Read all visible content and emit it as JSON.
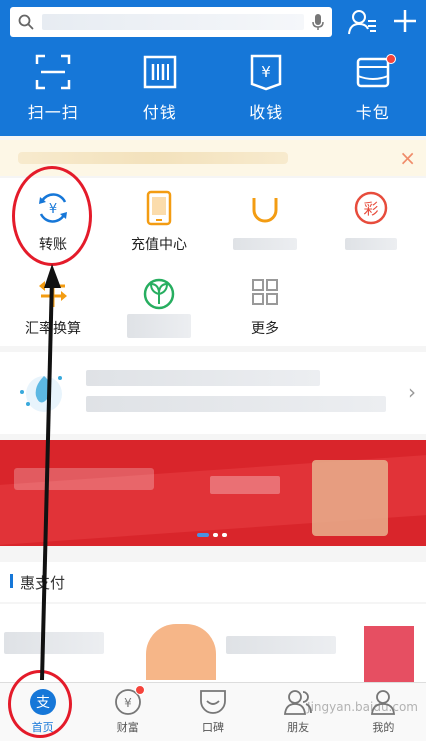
{
  "header": {
    "search_icon": "search-icon",
    "voice_icon": "microphone-icon",
    "contacts_icon": "contacts-icon",
    "add_icon": "plus-icon"
  },
  "quick_actions": [
    {
      "label": "扫一扫",
      "icon": "scan-icon"
    },
    {
      "label": "付钱",
      "icon": "pay-code-icon"
    },
    {
      "label": "收钱",
      "icon": "receive-money-icon"
    },
    {
      "label": "卡包",
      "icon": "card-wallet-icon",
      "badge": true
    }
  ],
  "notice": {
    "close": "×"
  },
  "apps": [
    {
      "label": "转账",
      "icon": "transfer-icon",
      "color": "#1677d8"
    },
    {
      "label": "充值中心",
      "icon": "top-up-icon",
      "color": "#f39c12"
    },
    {
      "label": "",
      "icon": "didi-icon",
      "color": "#f39c12"
    },
    {
      "label": "",
      "icon": "lottery-icon",
      "color": "#e74c3c"
    },
    {
      "label": "汇率换算",
      "icon": "exchange-rate-icon",
      "color": "#f39c12"
    },
    {
      "label": "",
      "icon": "ant-forest-icon",
      "color": "#27ae60"
    },
    {
      "label": "更多",
      "icon": "more-grid-icon",
      "color": "#999999"
    }
  ],
  "section": {
    "title": "惠支付"
  },
  "tabs": [
    {
      "label": "首页",
      "icon": "alipay-home-icon",
      "active": true
    },
    {
      "label": "财富",
      "icon": "wealth-icon",
      "badge": true
    },
    {
      "label": "口碑",
      "icon": "koubei-icon"
    },
    {
      "label": "朋友",
      "icon": "friends-icon"
    },
    {
      "label": "我的",
      "icon": "profile-icon"
    }
  ],
  "watermark": "Jingyan.baidu.com",
  "colors": {
    "brand": "#1677d8",
    "annotation": "#e41b2a",
    "badge": "#f5433b"
  }
}
